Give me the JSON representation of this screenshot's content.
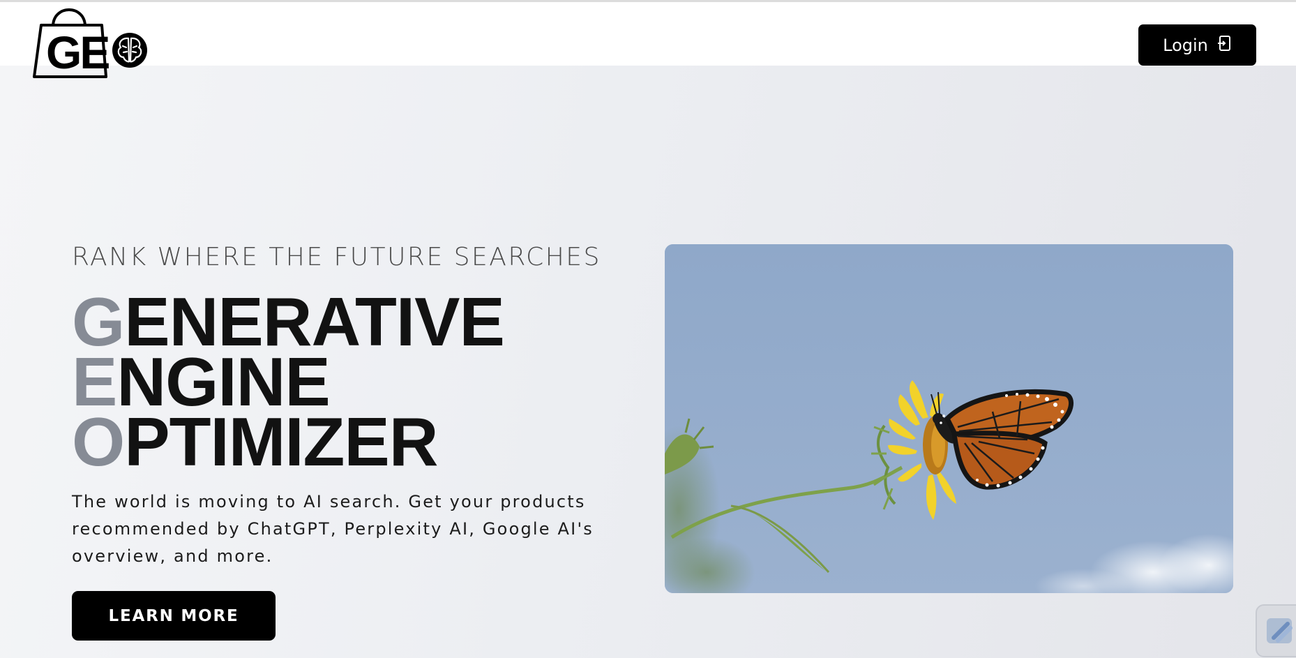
{
  "header": {
    "logo_text": "GE",
    "login_label": "Login"
  },
  "hero": {
    "tagline": "RANK WHERE THE FUTURE SEARCHES",
    "headline": [
      {
        "initial": "G",
        "rest": "ENERATIVE"
      },
      {
        "initial": "E",
        "rest": "NGINE"
      },
      {
        "initial": "O",
        "rest": "PTIMIZER"
      }
    ],
    "description": "The world is moving to AI search. Get your products recommended by ChatGPT, Perplexity AI, Google AI's overview, and more.",
    "cta_label": "LEARN MORE"
  },
  "icons": {
    "logo": "shopping-bag-brain-logo",
    "login": "login-door-icon",
    "chat": "chat-widget-icon"
  },
  "colors": {
    "accent_initial": "#868b95",
    "button_bg": "#000000",
    "sky": "#93abcb"
  }
}
